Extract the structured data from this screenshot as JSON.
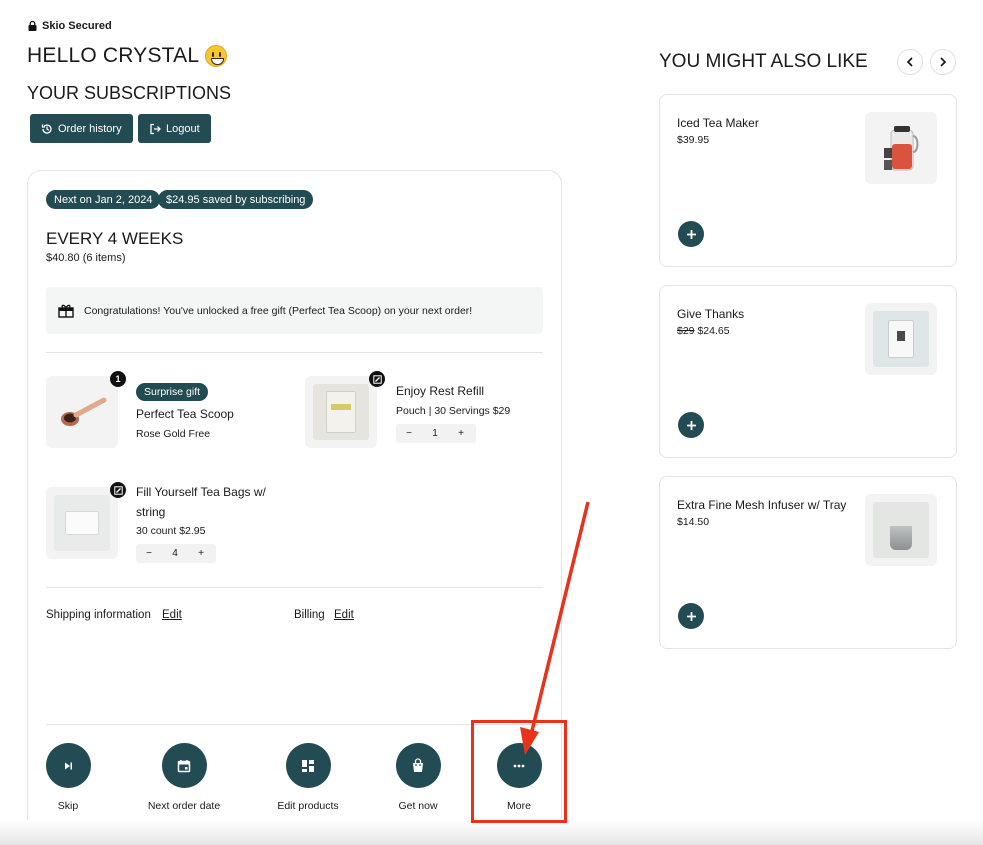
{
  "header": {
    "secured_label": "Skio Secured",
    "greeting": "HELLO CRYSTAL",
    "subscriptions_title": "YOUR SUBSCRIPTIONS",
    "order_history_label": "Order history",
    "logout_label": "Logout"
  },
  "subscription": {
    "next_date_pill": "Next on Jan 2, 2024",
    "savings_pill": "$24.95 saved by subscribing",
    "frequency": "EVERY 4 WEEKS",
    "price_summary": "$40.80 (6 items)",
    "gift_message": "Congratulations! You've unlocked a free gift (Perfect Tea Scoop) on your next order!",
    "items": [
      {
        "badge": "1",
        "tag": "Surprise gift",
        "name": "Perfect Tea Scoop",
        "detail": "Rose Gold Free"
      },
      {
        "name": "Enjoy Rest Refill",
        "detail": "Pouch | 30 Servings $29",
        "quantity": "1"
      },
      {
        "name_line1": "Fill Yourself Tea Bags w/",
        "name_line2": "string",
        "detail": "30 count $2.95",
        "quantity": "4"
      }
    ],
    "shipping_label": "Shipping information",
    "billing_label": "Billing",
    "edit_label": "Edit",
    "actions": {
      "skip": "Skip",
      "next_order_date": "Next order date",
      "edit_products": "Edit products",
      "get_now": "Get now",
      "more": "More"
    }
  },
  "recommendations": {
    "title": "YOU MIGHT ALSO LIKE",
    "items": [
      {
        "name": "Iced Tea Maker",
        "price": "$39.95"
      },
      {
        "name": "Give Thanks",
        "old_price": "$29",
        "price": "$24.65"
      },
      {
        "name": "Extra Fine Mesh Infuser w/ Tray",
        "price": "$14.50"
      }
    ]
  },
  "colors": {
    "accent": "#234b53",
    "annotation": "#e8321c"
  }
}
